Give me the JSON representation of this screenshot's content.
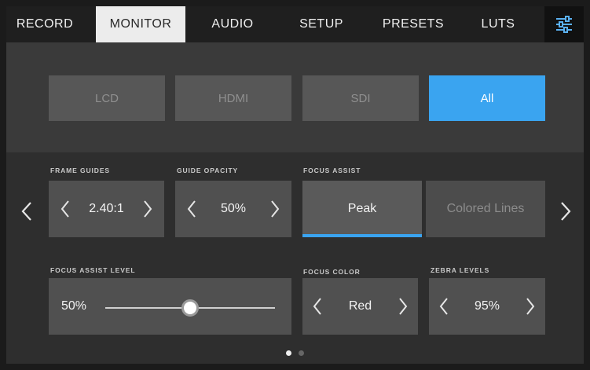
{
  "tabs": [
    {
      "label": "RECORD",
      "active": false
    },
    {
      "label": "MONITOR",
      "active": true
    },
    {
      "label": "AUDIO",
      "active": false
    },
    {
      "label": "SETUP",
      "active": false
    },
    {
      "label": "PRESETS",
      "active": false
    },
    {
      "label": "LUTS",
      "active": false
    }
  ],
  "settings_icon": "sliders-icon",
  "outputs": [
    {
      "label": "LCD",
      "active": false
    },
    {
      "label": "HDMI",
      "active": false
    },
    {
      "label": "SDI",
      "active": false
    },
    {
      "label": "All",
      "active": true
    }
  ],
  "frame_guides": {
    "label": "FRAME GUIDES",
    "value": "2.40:1"
  },
  "guide_opacity": {
    "label": "GUIDE OPACITY",
    "value": "50%"
  },
  "focus_assist": {
    "label": "FOCUS ASSIST",
    "options": [
      "Peak",
      "Colored Lines"
    ],
    "selected": "Peak"
  },
  "focus_assist_level": {
    "label": "FOCUS ASSIST LEVEL",
    "value": "50%",
    "level_fraction": 0.5
  },
  "focus_color": {
    "label": "FOCUS COLOR",
    "value": "Red"
  },
  "zebra_levels": {
    "label": "ZEBRA LEVELS",
    "value": "95%"
  },
  "pager": {
    "pages": 2,
    "current": 1
  },
  "colors": {
    "accent": "#3aa4f0",
    "tab_active_bg": "#ececec"
  }
}
